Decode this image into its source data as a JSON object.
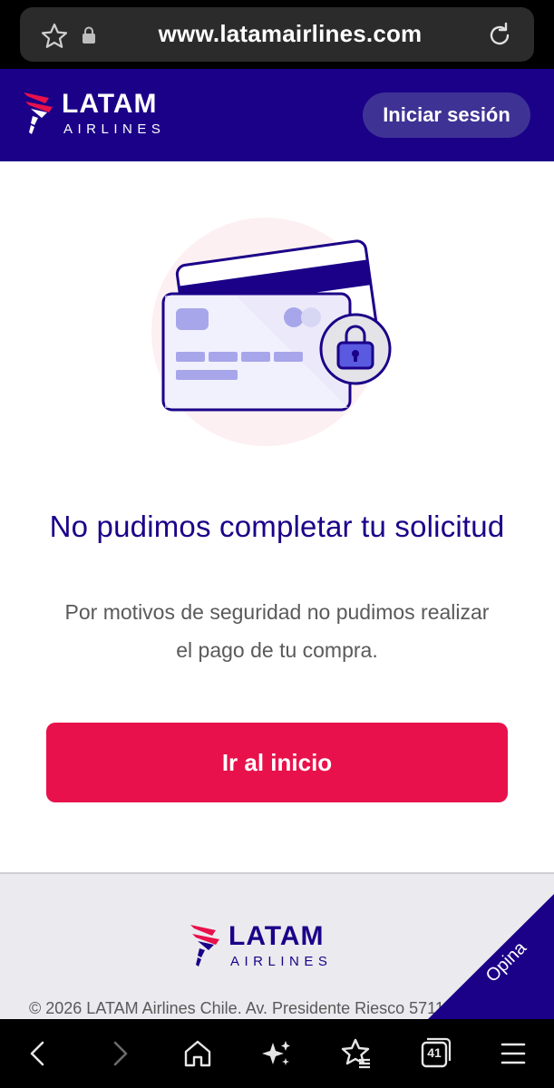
{
  "browser": {
    "url": "www.latamairlines.com",
    "tab_count": "41",
    "icons": {
      "favorite": "star-icon",
      "secure": "lock-icon",
      "reload": "reload-icon",
      "back": "back-icon",
      "forward": "forward-icon",
      "home": "home-icon",
      "assistant": "sparkles-icon",
      "bookmarks": "bookmarks-icon",
      "tabs": "tabs-icon",
      "menu": "menu-icon"
    }
  },
  "header": {
    "logo_word": "LATAM",
    "logo_sub": "AIRLINES",
    "login_label": "Iniciar sesión"
  },
  "main": {
    "illustration_icon": "credit-card-lock-icon",
    "title": "No pudimos completar tu solicitud",
    "subtitle": "Por motivos de seguridad no pudimos realizar el pago de tu compra.",
    "cta_label": "Ir al inicio"
  },
  "footer": {
    "logo_word": "LATAM",
    "logo_sub": "AIRLINES",
    "copyright": "© 2026 LATAM Airlines Chile. Av. Presidente Riesco 5711",
    "feedback_label": "Opina"
  },
  "colors": {
    "brand_navy": "#1b0088",
    "brand_red": "#e8114b",
    "login_button": "#3e3395"
  }
}
